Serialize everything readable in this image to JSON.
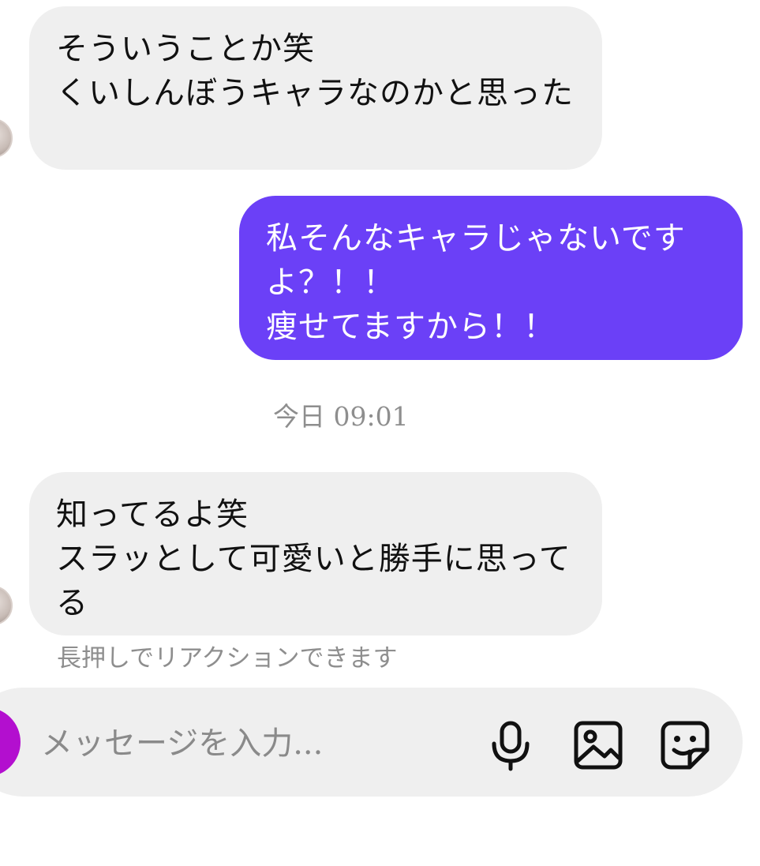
{
  "conversation": {
    "messages": [
      {
        "direction": "incoming",
        "text": "そういうことか笑\nくいしんぼうキャラなのかと思った"
      },
      {
        "direction": "outgoing",
        "text": "私そんなキャラじゃないですよ？！！\n痩せてますから！！"
      },
      {
        "direction": "incoming",
        "text": "知ってるよ笑\nスラッとして可愛いと勝手に思ってる"
      }
    ],
    "timestamp": "今日 09:01",
    "reaction_hint": "長押しでリアクションできます"
  },
  "composer": {
    "placeholder": "メッセージを入力...",
    "icons": {
      "camera": "camera-icon",
      "mic": "microphone-icon",
      "image": "image-icon",
      "sticker": "sticker-icon"
    }
  },
  "colors": {
    "outgoing_bubble": "#6b40f7",
    "incoming_bubble": "#efefef",
    "camera_button": "#b30fcf",
    "muted_text": "#8e8e8e"
  }
}
